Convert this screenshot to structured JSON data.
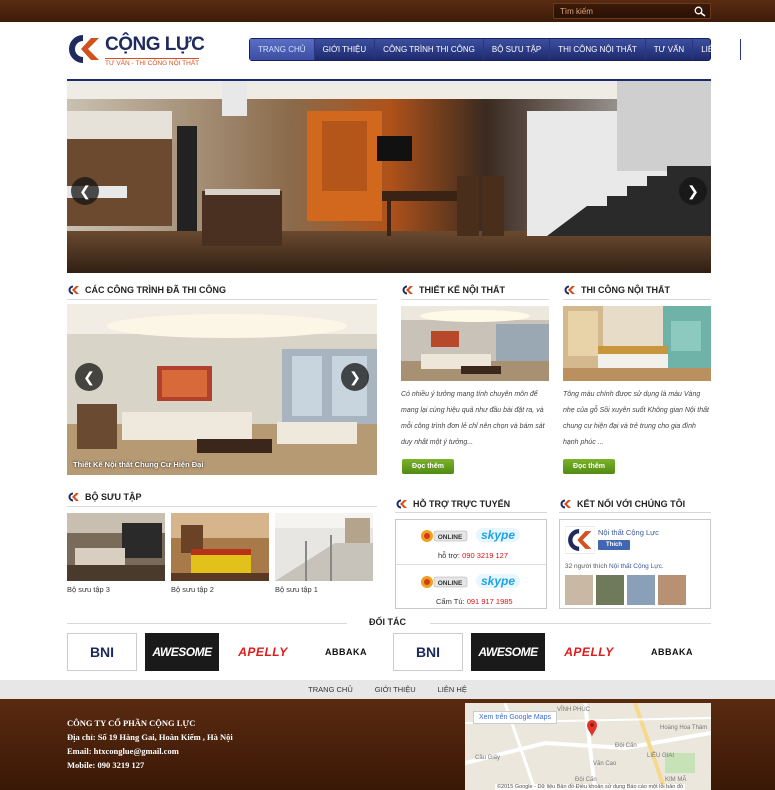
{
  "search": {
    "placeholder": "Tìm kiếm"
  },
  "logo": {
    "name": "CỘNG LỰC",
    "tagline": "TƯ VẤN - THI CÔNG NỘI THẤT"
  },
  "nav": [
    "TRANG CHỦ",
    "GIỚI THIỆU",
    "CÔNG TRÌNH THI CÔNG",
    "BỘ SƯU TẬP",
    "THI CÔNG NỘI THẤT",
    "TƯ VẤN",
    "LIÊN HỆ"
  ],
  "sections": {
    "completed": "CÁC CÔNG TRÌNH ĐÃ THI CÔNG",
    "design": "THIẾT KẾ NỘI THẤT",
    "construction": "THI CÔNG NỘI THẤT",
    "collection": "BỘ SƯU TẬP",
    "support": "HỖ TRỢ TRỰC TUYẾN",
    "connect": "KẾT NỐI VỚI CHÚNG TÔI",
    "partners": "ĐỐI TÁC"
  },
  "slider_caption": "Thiết Kế Nội thất Chung Cư Hiện Đại",
  "design_text": "Có nhiều ý tưởng mang tính chuyên môn để mang lại cùng hiệu quả như đầu bài đặt ra, và mỗi công trình đơn lẻ chỉ nên chọn và bám sát duy nhất một ý tưởng...",
  "construction_text": "Tông màu chính được sử dụng là màu Vàng nhẹ của gỗ Sồi xuyên suốt  Không gian Nội thất chung cư hiện đại và trẻ trung cho gia đình hạnh phúc ...",
  "read_more": "Đọc thêm",
  "collections": [
    "Bộ sưu tập 3",
    "Bộ sưu tập 2",
    "Bộ sưu tập 1"
  ],
  "support": [
    {
      "status": "ONLINE",
      "skype": "skype",
      "label": "hỗ trợ:",
      "phone": "090 3219 127"
    },
    {
      "status": "ONLINE",
      "skype": "skype",
      "label": "Cẩm Tú:",
      "phone": "091 917 1985"
    }
  ],
  "facebook": {
    "page": "Nội thất Cộng Lực",
    "like": "Thích",
    "count_text": "32 người thích",
    "count_link": "Nội thất Cộng Lực."
  },
  "partners": [
    "BNI",
    "AWESOME",
    "APELLY",
    "ABBAKA",
    "BNI",
    "AWESOME",
    "APELLY",
    "ABBAKA"
  ],
  "footer_nav": [
    "TRANG CHỦ",
    "GIỚI THIỆU",
    "LIÊN HỆ"
  ],
  "footer": {
    "company": "CÔNG TY CỔ PHẦN CỘNG LỰC",
    "address": "Địa chỉ: Số 19 Hàng Gai, Hoàn Kiếm , Hà Nội",
    "email": "Email: htxconglue@gmail.com",
    "mobile": "Mobile: 090 3219 127"
  },
  "map": {
    "link": "Xem trên Google Maps",
    "attribution": "©2015 Google - Dữ liệu Bản đồ   Điều khoản sử dụng   Báo cáo một lỗi bản đồ",
    "labels": [
      "VĨNH PHÚC",
      "Hoàng Hoa Thám",
      "Đội Cấn",
      "LIỄU GIAI",
      "Cầu Giấy",
      "KIM MÃ",
      "Văn Cao",
      "Đội Cấn"
    ]
  },
  "colors": {
    "brand_navy": "#1f2b5c",
    "brand_orange": "#d2521f",
    "nav_bg": "#2d3b8a",
    "footer_bg": "#4a2210",
    "green_button": "#6aa321"
  }
}
